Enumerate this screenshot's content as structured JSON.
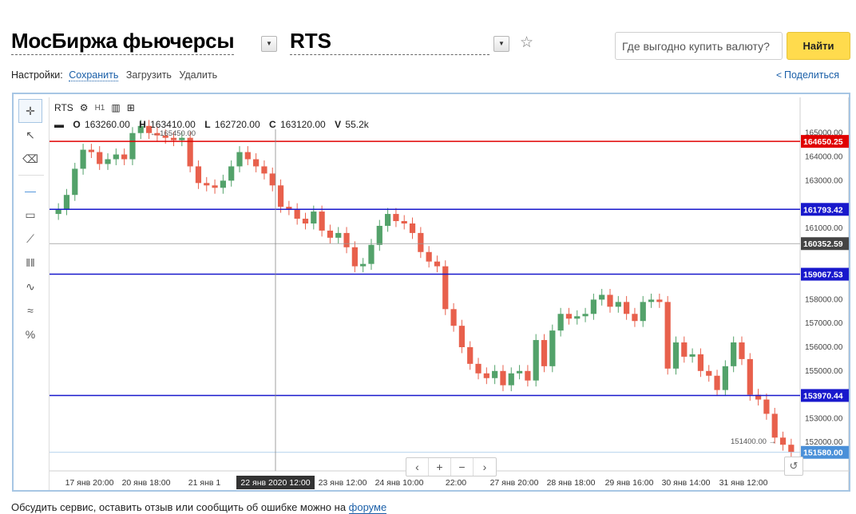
{
  "header": {
    "exchange_title": "МосБиржа фьючерсы",
    "ticker_title": "RTS",
    "dropdown_icon": "caret-down-icon",
    "star_icon": "star-outline-icon"
  },
  "search": {
    "placeholder": "Где выгодно купить валюту?",
    "button_label": "Найти"
  },
  "settings": {
    "label": "Настройки:",
    "save": "Сохранить",
    "load": "Загрузить",
    "delete": "Удалить",
    "share": "Поделиться"
  },
  "colors": {
    "up": "#53a26a",
    "down": "#e8604c",
    "resistance_line": "#e00000",
    "support_line": "#1818cc",
    "current_price": "#4a90d9",
    "crosshair_label": "#333333"
  },
  "chart_legend": {
    "symbol": "RTS",
    "timeframe": "H1",
    "open_label": "O",
    "open": "163260.00",
    "high_label": "H",
    "high": "163410.00",
    "low_label": "L",
    "low": "162720.00",
    "close_label": "C",
    "close": "163120.00",
    "volume_label": "V",
    "volume": "55.2k"
  },
  "toolbar": [
    {
      "name": "crosshair-tool-icon",
      "glyph": "✛"
    },
    {
      "name": "cursor-tool-icon",
      "glyph": "↖"
    },
    {
      "name": "eraser-tool-icon",
      "glyph": "⌫"
    },
    {
      "name": "horizontal-line-tool-icon",
      "glyph": "—"
    },
    {
      "name": "rectangle-tool-icon",
      "glyph": "▭"
    },
    {
      "name": "trend-line-tool-icon",
      "glyph": "⟋"
    },
    {
      "name": "vertical-lines-tool-icon",
      "glyph": "‖‖"
    },
    {
      "name": "path-tool-icon",
      "glyph": "∿"
    },
    {
      "name": "wave-tool-icon",
      "glyph": "≈"
    },
    {
      "name": "percent-tool-icon",
      "glyph": "%"
    }
  ],
  "navigation": {
    "prev": "‹",
    "zoom_in": "+",
    "zoom_out": "−",
    "next": "›",
    "reset": "↺"
  },
  "chart_data": {
    "type": "candlestick",
    "symbol": "RTS",
    "timeframe": "H1",
    "ylim": [
      150800,
      166500
    ],
    "y_ticks": [
      152000,
      153000,
      154000,
      155000,
      156000,
      157000,
      158000,
      161000,
      163000,
      164000,
      165000
    ],
    "x_labels": [
      "17 янв 20:00",
      "20 янв 18:00",
      "21 янв 1",
      "23 янв 12:00",
      "24 янв 10:00",
      "22:00",
      "27 янв 20:00",
      "28 янв 18:00",
      "29 янв 16:00",
      "30 янв 14:00",
      "31 янв 12:00"
    ],
    "crosshair_label": "22 янв 2020 12:00",
    "max_marker": "165450.00",
    "min_marker": "151400.00",
    "horizontal_levels": [
      {
        "value": 164650.25,
        "label": "164650.25",
        "kind": "resistance"
      },
      {
        "value": 161793.42,
        "label": "161793.42",
        "kind": "support"
      },
      {
        "value": 160352.59,
        "label": "160352.59",
        "kind": "crosshair"
      },
      {
        "value": 159067.53,
        "label": "159067.53",
        "kind": "support"
      },
      {
        "value": 153970.44,
        "label": "153970.44",
        "kind": "support"
      },
      {
        "value": 151580.0,
        "label": "151580.00",
        "kind": "last_price"
      }
    ],
    "close_path": [
      161800,
      162400,
      163500,
      164300,
      164200,
      163700,
      163900,
      164100,
      163900,
      165000,
      165300,
      165000,
      164900,
      164800,
      164700,
      164800,
      163600,
      162900,
      162800,
      162700,
      163000,
      163600,
      164200,
      163900,
      163600,
      163300,
      162800,
      161900,
      161800,
      161400,
      161200,
      161700,
      160900,
      160600,
      160800,
      160200,
      159400,
      159500,
      160300,
      161100,
      161600,
      161300,
      161200,
      160800,
      160000,
      159600,
      159400,
      157600,
      156900,
      156000,
      155300,
      154900,
      154700,
      155000,
      154400,
      154900,
      155000,
      154600,
      156300,
      155200,
      156700,
      157400,
      157200,
      157300,
      157400,
      158000,
      158200,
      157700,
      157900,
      157400,
      157100,
      157900,
      158000,
      157900,
      155100,
      156200,
      155600,
      155700,
      155000,
      154800,
      154200,
      155200,
      156200,
      155500,
      154000,
      153800,
      153200,
      152200,
      151900,
      151600
    ]
  }
}
